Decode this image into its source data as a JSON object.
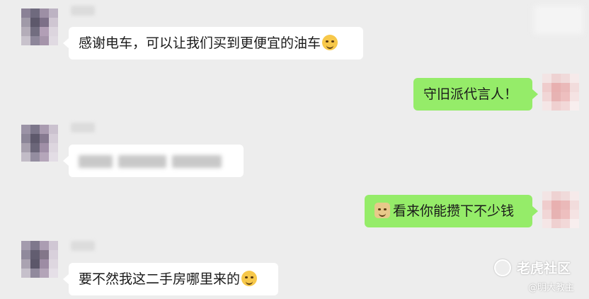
{
  "messages": [
    {
      "side": "left",
      "text": "感谢电车，可以让我们买到更便宜的油车",
      "emoji": "grin-squint-emoji"
    },
    {
      "side": "right",
      "text": "守旧派代言人！"
    },
    {
      "side": "left",
      "text": "",
      "blurred": true
    },
    {
      "side": "right",
      "text": "看来你能攒下不少钱",
      "emoji": "doge-emoji"
    },
    {
      "side": "left",
      "text": "要不然我这二手房哪里来的",
      "emoji": "dizzy-sweat-emoji"
    }
  ],
  "watermark": {
    "logo_text": "老虎社区",
    "handle": "@明大教主"
  },
  "colors": {
    "background": "#ededed",
    "left_bubble": "#ffffff",
    "right_bubble": "#95ec69",
    "text": "#1a1a1a"
  }
}
